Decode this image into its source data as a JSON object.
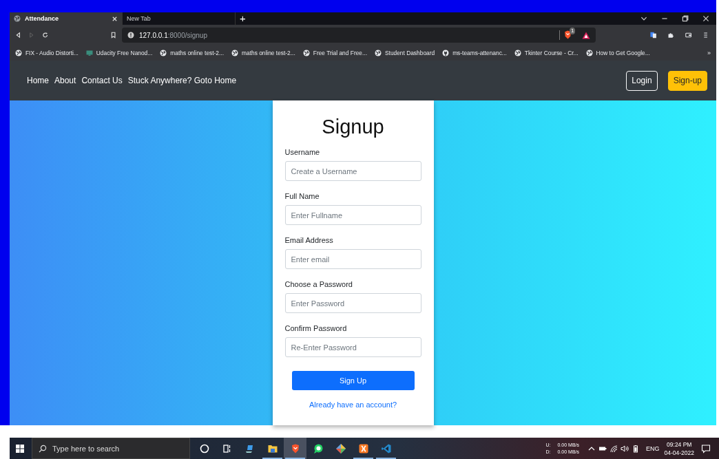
{
  "browser": {
    "tabs": [
      {
        "title": "Attendance",
        "selected": true
      },
      {
        "title": "New Tab",
        "selected": false
      }
    ],
    "new_tab": "+",
    "address": {
      "host": "127.0.0.1",
      "path": ":8000/signup"
    },
    "shield_count": "1",
    "bookmarks": [
      {
        "kind": "globe",
        "label": "FIX - Audio Distorti..."
      },
      {
        "kind": "udacity",
        "label": "Udacity Free Nanod..."
      },
      {
        "kind": "globe",
        "label": "maths online test-2..."
      },
      {
        "kind": "globe",
        "label": "maths online test-2..."
      },
      {
        "kind": "globe",
        "label": "Free Trial and Free..."
      },
      {
        "kind": "globe",
        "label": "Student Dashboard"
      },
      {
        "kind": "github",
        "label": "ms-teams-attenanc..."
      },
      {
        "kind": "globe",
        "label": "Tkinter Course - Cr..."
      },
      {
        "kind": "globe",
        "label": "How to Get Google..."
      }
    ],
    "more_bookmarks": "»"
  },
  "navbar": {
    "links": [
      "Home",
      "About",
      "Contact Us",
      "Stuck Anywhere? Goto Home"
    ],
    "buttons": [
      {
        "label": "Login",
        "kind": "outline"
      },
      {
        "label": "Sign-up",
        "kind": "warning"
      }
    ]
  },
  "form": {
    "title": "Signup",
    "fields": [
      {
        "label": "Username",
        "placeholder": "Create a Username"
      },
      {
        "label": "Full Name",
        "placeholder": "Enter Fullname"
      },
      {
        "label": "Email Address",
        "placeholder": "Enter email"
      },
      {
        "label": "Choose a Password",
        "placeholder": "Enter Password"
      },
      {
        "label": "Confirm Password",
        "placeholder": "Re-Enter Password"
      }
    ],
    "submit": "Sign Up",
    "link": "Already have an account?"
  },
  "taskbar": {
    "search_placeholder": "Type here to search",
    "apps": [
      {
        "kind": "cortana",
        "running": false,
        "selected": false
      },
      {
        "kind": "taskview",
        "running": false,
        "selected": false
      },
      {
        "kind": "person",
        "running": false,
        "selected": false
      },
      {
        "kind": "folder",
        "running": true,
        "selected": false
      },
      {
        "kind": "brave",
        "running": true,
        "selected": true
      },
      {
        "kind": "whatsapp",
        "running": false,
        "selected": false
      },
      {
        "kind": "git",
        "running": false,
        "selected": false
      },
      {
        "kind": "xampp",
        "running": true,
        "selected": false
      },
      {
        "kind": "vscode",
        "running": true,
        "selected": false
      }
    ],
    "net_labels": [
      "U:",
      "D:"
    ],
    "net_speeds": [
      "0.00 MB/s",
      "0.00 MB/s"
    ],
    "language": "ENG",
    "time": "09:24 PM",
    "date": "04-04-2022"
  }
}
